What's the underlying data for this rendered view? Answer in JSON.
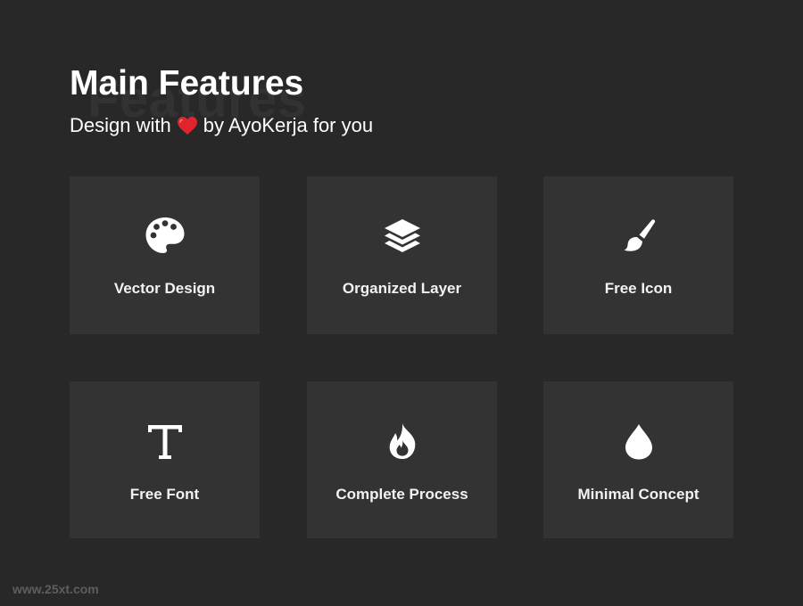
{
  "header": {
    "bg_word": "Features",
    "title": "Main Features",
    "subtitle_before": "Design with",
    "subtitle_after": "by AyoKerja for you",
    "heart_color": "#e0242e"
  },
  "features": [
    {
      "label": "Vector Design",
      "icon": "palette-icon"
    },
    {
      "label": "Organized Layer",
      "icon": "layers-icon"
    },
    {
      "label": "Free Icon",
      "icon": "brush-icon"
    },
    {
      "label": "Free Font",
      "icon": "type-icon"
    },
    {
      "label": "Complete Process",
      "icon": "flame-icon"
    },
    {
      "label": "Minimal Concept",
      "icon": "droplet-icon"
    }
  ],
  "watermark": "www.25xt.com",
  "colors": {
    "background": "#282828",
    "card": "#333333",
    "text": "#ffffff"
  }
}
